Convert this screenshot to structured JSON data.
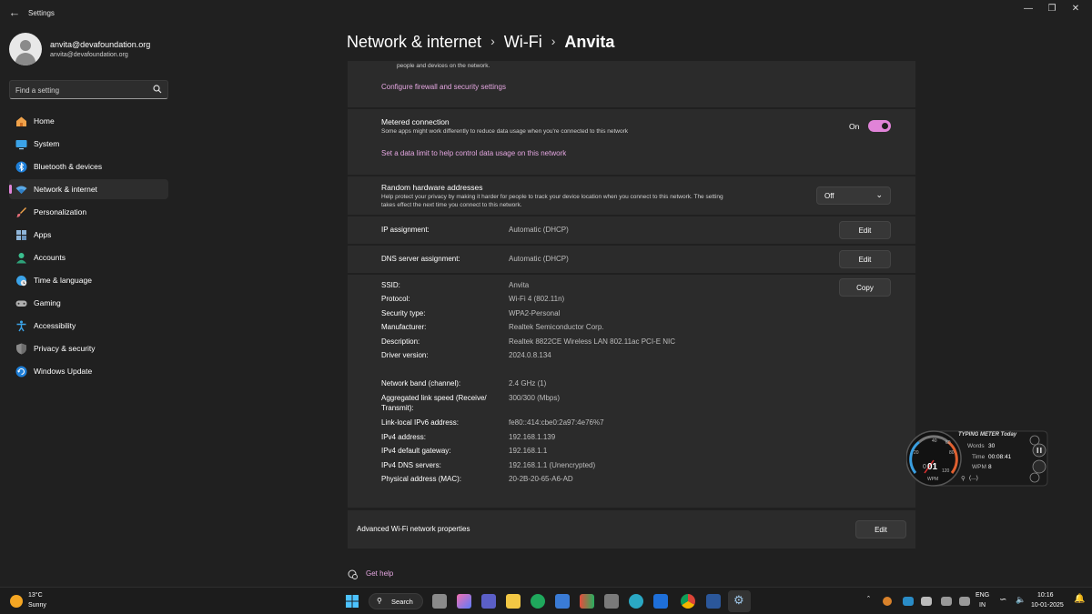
{
  "window": {
    "title": "Settings"
  },
  "profile": {
    "name": "anvita@devafoundation.org",
    "email": "anvita@devafoundation.org"
  },
  "search": {
    "placeholder": "Find a setting"
  },
  "nav": [
    {
      "label": "Home",
      "icon": "home-icon"
    },
    {
      "label": "System",
      "icon": "system-icon"
    },
    {
      "label": "Bluetooth & devices",
      "icon": "bluetooth-icon"
    },
    {
      "label": "Network & internet",
      "icon": "wifi-icon",
      "active": true
    },
    {
      "label": "Personalization",
      "icon": "brush-icon"
    },
    {
      "label": "Apps",
      "icon": "apps-icon"
    },
    {
      "label": "Accounts",
      "icon": "accounts-icon"
    },
    {
      "label": "Time & language",
      "icon": "globe-clock-icon"
    },
    {
      "label": "Gaming",
      "icon": "gamepad-icon"
    },
    {
      "label": "Accessibility",
      "icon": "accessibility-icon"
    },
    {
      "label": "Privacy & security",
      "icon": "shield-icon"
    },
    {
      "label": "Windows Update",
      "icon": "update-icon"
    }
  ],
  "breadcrumb": {
    "level1": "Network & internet",
    "level2": "Wi-Fi",
    "current": "Anvita"
  },
  "firewall": {
    "desc_tail": "people and devices on the network.",
    "link": "Configure firewall and security settings"
  },
  "metered": {
    "title": "Metered connection",
    "desc": "Some apps might work differently to reduce data usage when you're connected to this network",
    "state_label": "On",
    "toggle_on": true,
    "link": "Set a data limit to help control data usage on this network"
  },
  "random_hw": {
    "title": "Random hardware addresses",
    "desc_line1": "Help protect your privacy by making it harder for people to track your device location when you connect to this network. The setting",
    "desc_line2": "takes effect the next time you connect to this network.",
    "value": "Off"
  },
  "ip_assignment": {
    "label": "IP assignment:",
    "value": "Automatic (DHCP)",
    "button": "Edit"
  },
  "dns_assignment": {
    "label": "DNS server assignment:",
    "value": "Automatic (DHCP)",
    "button": "Edit"
  },
  "properties": {
    "copy_button": "Copy",
    "group1": [
      {
        "label": "SSID:",
        "value": "Anvita"
      },
      {
        "label": "Protocol:",
        "value": "Wi-Fi 4 (802.11n)"
      },
      {
        "label": "Security type:",
        "value": "WPA2-Personal"
      },
      {
        "label": "Manufacturer:",
        "value": "Realtek Semiconductor Corp."
      },
      {
        "label": "Description:",
        "value": "Realtek 8822CE Wireless LAN 802.11ac PCI-E NIC"
      },
      {
        "label": "Driver version:",
        "value": "2024.0.8.134"
      }
    ],
    "band": {
      "label": "Network band (channel):",
      "value": "2.4 GHz (1)"
    },
    "link_speed": {
      "label_line1": "Aggregated link speed (Receive/",
      "label_line2": "Transmit):",
      "value": "300/300 (Mbps)"
    },
    "group2": [
      {
        "label": "Link-local IPv6 address:",
        "value": "fe80::414:cbe0:2a97:4e76%7"
      },
      {
        "label": "IPv4 address:",
        "value": "192.168.1.139"
      },
      {
        "label": "IPv4 default gateway:",
        "value": "192.168.1.1"
      },
      {
        "label": "IPv4 DNS servers:",
        "value": "192.168.1.1 (Unencrypted)"
      },
      {
        "label": "Physical address (MAC):",
        "value": "20-2B-20-65-A6-AD"
      }
    ]
  },
  "advanced": {
    "label": "Advanced Wi-Fi network properties",
    "button": "Edit"
  },
  "help": {
    "label": "Get help"
  },
  "typing_meter": {
    "title": "TYPING METER Today",
    "words_label": "Words",
    "words_value": "30",
    "time_label": "Time",
    "time_value": "00:08:41",
    "wpm_label": "WPM",
    "wpm_value": "8",
    "gauge_value": "01",
    "gauge_unit": "WPM",
    "gauge_ticks": [
      "0",
      "20",
      "40",
      "60",
      "80",
      "120"
    ],
    "search_text": "(...)"
  },
  "taskbar": {
    "weather_temp": "13°C",
    "weather_desc": "Sunny",
    "search_label": "Search",
    "lang_line1": "ENG",
    "lang_line2": "IN",
    "time": "10:16",
    "date": "10-01-2025"
  },
  "colors": {
    "accent": "#e083d8",
    "link": "#e4a6e0",
    "card": "#2b2b2b",
    "background": "#202020"
  }
}
